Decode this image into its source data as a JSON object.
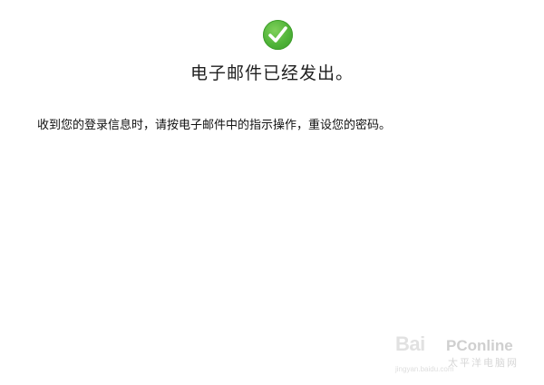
{
  "status": {
    "icon": "checkmark-circle-icon",
    "icon_color": "#4fb338",
    "title": "电子邮件已经发出。"
  },
  "message": {
    "text": "收到您的登录信息时，请按电子邮件中的指示操作，重设您的密码。"
  },
  "watermark": {
    "brand": "Bai",
    "site": "PConline",
    "site_cn": "太平洋电脑网",
    "url": "jingyan.baidu.com"
  }
}
